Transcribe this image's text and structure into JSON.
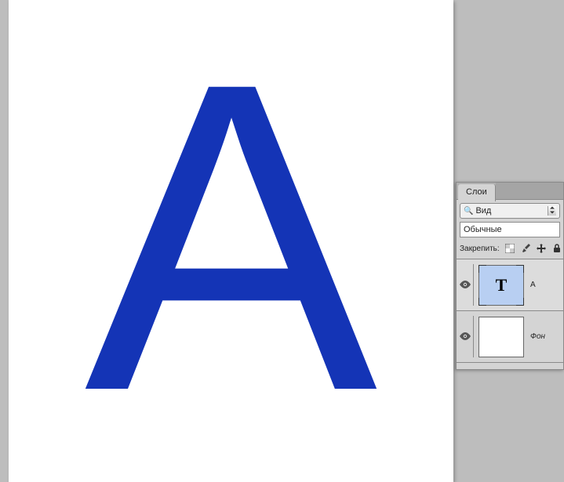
{
  "canvas": {
    "letter": "А",
    "letter_color": "#1434b6"
  },
  "panel": {
    "tab_label": "Слои",
    "filter_dropdown": {
      "icon": "search",
      "value": "Вид"
    },
    "blend_mode": "Обычные",
    "lock_label": "Закрепить:",
    "lock_icons": [
      "transparency",
      "brush",
      "move",
      "lock"
    ],
    "layers": [
      {
        "type": "text",
        "visible": true,
        "name": "А",
        "selected": true,
        "thumb_symbol": "T"
      },
      {
        "type": "background",
        "visible": true,
        "name": "Фон",
        "selected": false,
        "italic": true
      }
    ]
  }
}
